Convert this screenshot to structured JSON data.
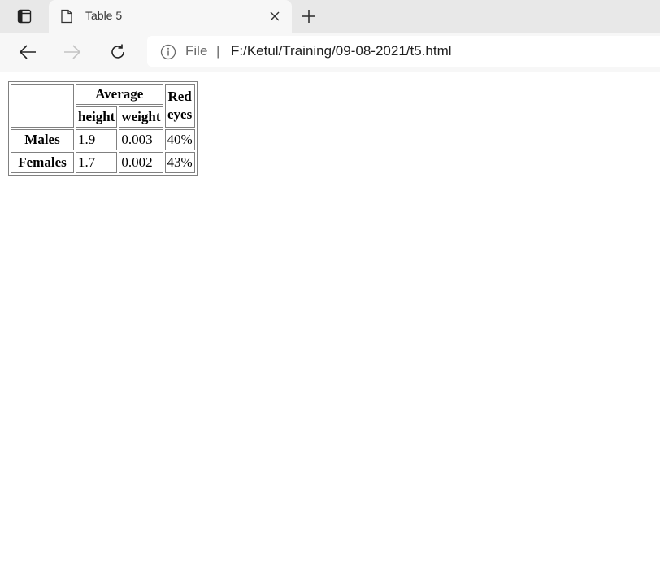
{
  "browser": {
    "tab": {
      "title": "Table 5"
    },
    "address": {
      "scheme": "File",
      "separator": "|",
      "url": "F:/Ketul/Training/09-08-2021/t5.html"
    },
    "icons": {
      "tab_actions": "tab-actions-icon",
      "page": "page-icon",
      "close": "close-icon",
      "new_tab": "plus-icon",
      "back": "arrow-left-icon",
      "forward": "arrow-right-icon",
      "refresh": "refresh-icon",
      "info": "info-icon"
    }
  },
  "table": {
    "header_group": "Average",
    "header_last_line1": "Red",
    "header_last_line2": "eyes",
    "sub_headers": [
      "height",
      "weight"
    ],
    "rows": [
      {
        "label": "Males",
        "height": "1.9",
        "weight": "0.003",
        "red_eyes": "40%"
      },
      {
        "label": "Females",
        "height": "1.7",
        "weight": "0.002",
        "red_eyes": "43%"
      }
    ]
  }
}
